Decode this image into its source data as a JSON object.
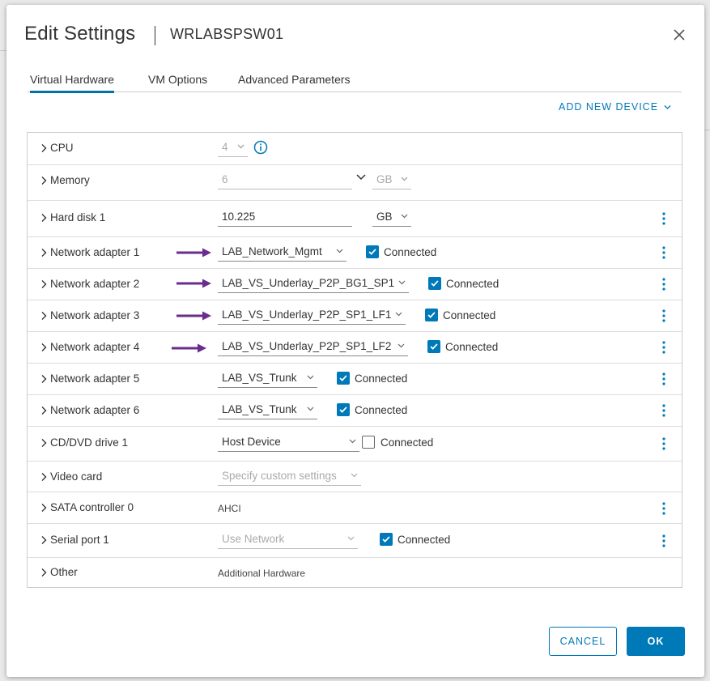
{
  "dialog": {
    "title": "Edit Settings",
    "vm_name": "WRLABSPSW01"
  },
  "tabs": [
    {
      "label": "Virtual Hardware",
      "active": true
    },
    {
      "label": "VM Options",
      "active": false
    },
    {
      "label": "Advanced Parameters",
      "active": false
    }
  ],
  "add_device_label": "ADD NEW DEVICE",
  "rows": {
    "cpu": {
      "label": "CPU",
      "value": "4"
    },
    "memory": {
      "label": "Memory",
      "value": "6",
      "unit": "GB"
    },
    "hdd": {
      "label": "Hard disk 1",
      "value": "10.225",
      "unit": "GB"
    },
    "net1": {
      "label": "Network adapter 1",
      "network": "LAB_Network_Mgmt",
      "connected_label": "Connected",
      "connected": true
    },
    "net2": {
      "label": "Network adapter 2",
      "network": "LAB_VS_Underlay_P2P_BG1_SP1",
      "connected_label": "Connected",
      "connected": true
    },
    "net3": {
      "label": "Network adapter 3",
      "network": "LAB_VS_Underlay_P2P_SP1_LF1",
      "connected_label": "Connected",
      "connected": true
    },
    "net4": {
      "label": "Network adapter 4",
      "network": "LAB_VS_Underlay_P2P_SP1_LF2",
      "connected_label": "Connected",
      "connected": true
    },
    "net5": {
      "label": "Network adapter 5",
      "network": "LAB_VS_Trunk",
      "connected_label": "Connected",
      "connected": true
    },
    "net6": {
      "label": "Network adapter 6",
      "network": "LAB_VS_Trunk",
      "connected_label": "Connected",
      "connected": true
    },
    "cd": {
      "label": "CD/DVD drive 1",
      "value": "Host Device",
      "connected_label": "Connected",
      "connected": false
    },
    "video": {
      "label": "Video card",
      "value": "Specify custom settings"
    },
    "sata": {
      "label": "SATA controller 0",
      "value": "AHCI"
    },
    "serial": {
      "label": "Serial port 1",
      "value": "Use Network",
      "connected_label": "Connected",
      "connected": true
    },
    "other": {
      "label": "Other",
      "value": "Additional Hardware"
    }
  },
  "buttons": {
    "cancel": "CANCEL",
    "ok": "OK"
  },
  "colors": {
    "accent": "#0079b8",
    "arrow": "#6a2c8f"
  }
}
